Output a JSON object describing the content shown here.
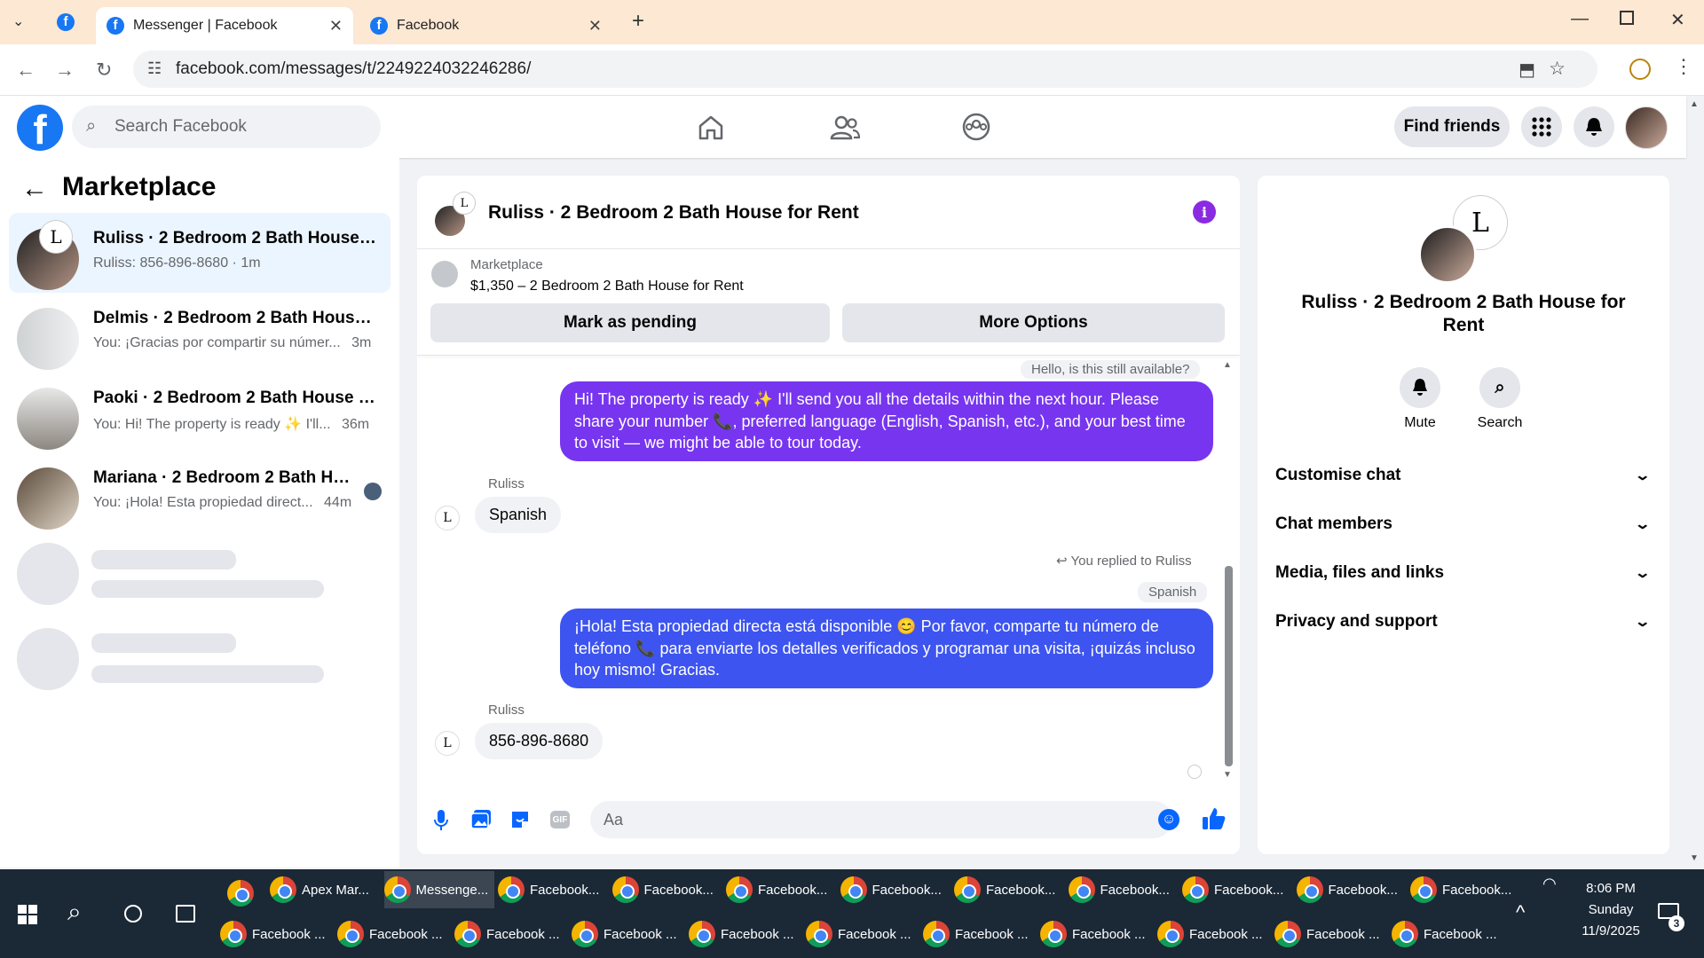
{
  "browser": {
    "tabs": [
      {
        "title": "Messenger | Facebook",
        "active": true
      },
      {
        "title": "Facebook",
        "active": false
      }
    ],
    "url": "facebook.com/messages/t/2249224032246286/"
  },
  "fb_header": {
    "search_placeholder": "Search Facebook",
    "find_friends": "Find friends"
  },
  "sidebar": {
    "title": "Marketplace",
    "conversations": [
      {
        "title": "Ruliss · 2 Bedroom 2 Bath House f...",
        "snippet": "Ruliss: 856-896-8680 · 1m"
      },
      {
        "title": "Delmis · 2 Bedroom 2 Bath House ...",
        "snippet": "You: ¡Gracias por compartir su númer...",
        "time": "3m"
      },
      {
        "title": "Paoki · 2 Bedroom 2 Bath House f...",
        "snippet": "You: Hi! The property is ready ✨ I'll...",
        "time": "36m"
      },
      {
        "title": "Mariana · 2 Bedroom 2 Bath Ho...",
        "snippet": "You: ¡Hola! Esta propiedad direct...",
        "time": "44m"
      }
    ]
  },
  "chat": {
    "header_title": "Ruliss · 2 Bedroom 2 Bath House for Rent",
    "listing_source": "Marketplace",
    "listing_price": "$1,350 – 2 Bedroom 2 Bath House for Rent",
    "mark_pending": "Mark as pending",
    "more_options": "More Options",
    "quoted": "Hello, is this still available?",
    "msg1": "Hi! The property is ready ✨ I'll send you all the details within the next hour. Please share your number 📞, preferred language (English, Spanish, etc.), and your best time to visit — we might be able to tour today.",
    "sender1": "Ruliss",
    "reply1": "Spanish",
    "replied_label": "You replied to Ruliss",
    "replied_quote": "Spanish",
    "msg2": "¡Hola! Esta propiedad directa está disponible 😊 Por favor, comparte tu número de teléfono 📞 para enviarte los detalles verificados y programar una visita, ¡quizás incluso hoy mismo! Gracias.",
    "sender2": "Ruliss",
    "reply2": "856-896-8680",
    "input_placeholder": "Aa"
  },
  "right_panel": {
    "title": "Ruliss · 2 Bedroom 2 Bath House for Rent",
    "mute": "Mute",
    "search": "Search",
    "sections": [
      "Customise chat",
      "Chat members",
      "Media, files and links",
      "Privacy and support"
    ]
  },
  "taskbar": {
    "row1": [
      "Apex Mar...",
      "Messenge...",
      "Facebook...",
      "Facebook...",
      "Facebook...",
      "Facebook...",
      "Facebook...",
      "Facebook...",
      "Facebook...",
      "Facebook...",
      "Facebook..."
    ],
    "row2": [
      "Facebook ...",
      "Facebook ...",
      "Facebook ...",
      "Facebook ...",
      "Facebook ...",
      "Facebook ...",
      "Facebook ...",
      "Facebook ...",
      "Facebook ...",
      "Facebook ...",
      "Facebook ..."
    ],
    "time": "8:06 PM",
    "day": "Sunday",
    "date": "11/9/2025",
    "notif_count": "3"
  },
  "colors": {
    "accent": "#1877f2",
    "bubble_purple": "#7735f0",
    "bubble_blue": "#3d54f0",
    "info": "#8a2be2"
  }
}
